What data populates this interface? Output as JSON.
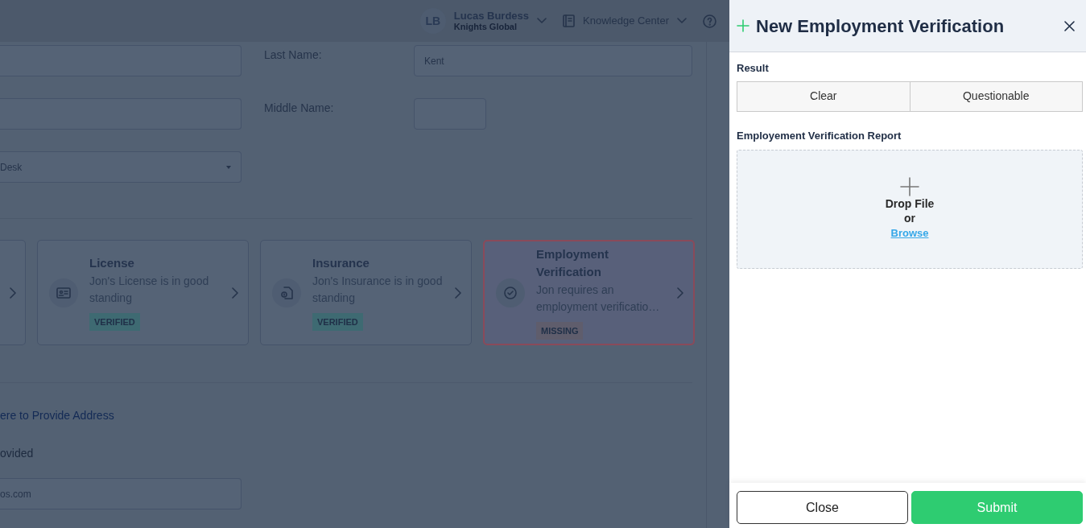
{
  "header": {
    "user": {
      "initials": "LB",
      "name": "Lucas Burdess",
      "org": "Knights Global"
    },
    "knowledge_center": "Knowledge Center"
  },
  "form": {
    "rows": [
      {
        "left": {
          "kind": "input"
        },
        "label": "Last Name:",
        "right": {
          "kind": "input",
          "value": "Kent"
        }
      },
      {
        "left": {
          "kind": "input"
        },
        "label": "Middle Name:",
        "right": {
          "kind": "short"
        }
      },
      {
        "left": {
          "kind": "select",
          "value": "Desk"
        }
      }
    ]
  },
  "cards": [
    {
      "kind": "partial"
    },
    {
      "kind": "card",
      "title": "License",
      "body": "Jon's License is in good standing",
      "status": "VERIFIED",
      "color": "#3e6a72",
      "selected": false
    },
    {
      "kind": "card",
      "title": "Insurance",
      "body": "Jon's Insurance is in good standing",
      "status": "VERIFIED",
      "color": "#3e6a72",
      "selected": false
    },
    {
      "kind": "card",
      "title": "Employment Verification",
      "body": "Jon requires an employment verificatio…",
      "status": "MISSING",
      "color": "#5f5d6c",
      "selected": true
    }
  ],
  "address": {
    "link": "ere to Provide Address",
    "note": "ovided",
    "email": "os.com"
  },
  "panel": {
    "title": "New Employment Verification",
    "result_label": "Result",
    "options": [
      {
        "label": "Clear",
        "selected": false
      },
      {
        "label": "Questionable",
        "selected": false
      }
    ],
    "report_label": "Employement Verification Report",
    "drop": {
      "text": "Drop File",
      "or": "or",
      "browse": "Browse"
    },
    "buttons": [
      {
        "kind": "secondary",
        "label": "Close"
      },
      {
        "kind": "primary",
        "label": "Submit"
      }
    ]
  }
}
